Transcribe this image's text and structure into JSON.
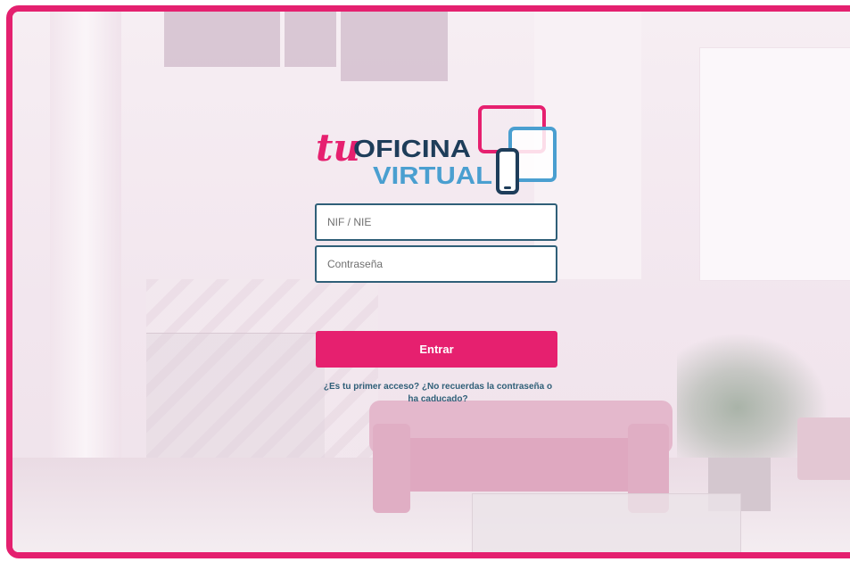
{
  "logo": {
    "word_tu": "tu",
    "word_oficina": "OFICINA",
    "word_virtual": "VIRTUAL"
  },
  "login": {
    "user_placeholder": "NIF / NIE",
    "password_placeholder": "Contraseña",
    "submit_label": "Entrar"
  },
  "help": {
    "first_access": "¿Es tu primer acceso?",
    "forgot_password": "¿No recuerdas la contraseña o ha caducado?"
  },
  "colors": {
    "accent": "#e6206f",
    "border": "#e4206f",
    "navy": "#2f5f78",
    "logo_blue": "#4a9fd0"
  }
}
